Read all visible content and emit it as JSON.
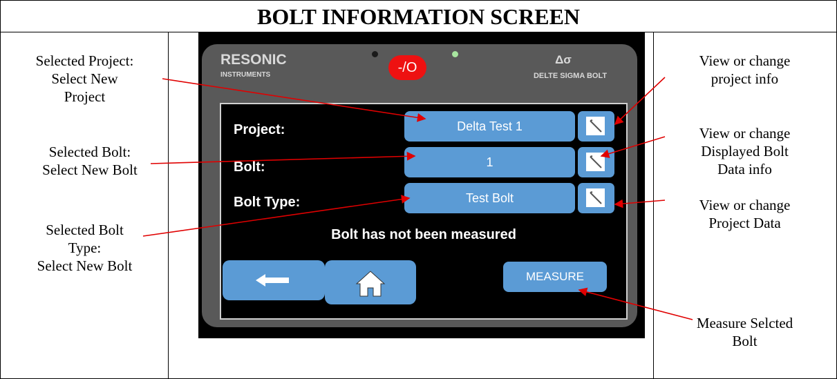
{
  "title": "BOLT INFORMATION SCREEN",
  "annotations": {
    "selected_project": [
      "Selected Project:",
      "Select New",
      "Project"
    ],
    "selected_bolt": [
      "Selected Bolt:",
      "Select New Bolt"
    ],
    "selected_bolt_type": [
      "Selected Bolt",
      "Type:",
      "Select New Bolt"
    ],
    "project_info": [
      "View or change",
      "project info"
    ],
    "bolt_data_info": [
      "View or change",
      "Displayed Bolt",
      "Data info"
    ],
    "project_data": [
      "View or change",
      "Project Data"
    ],
    "measure": [
      "Measure Selcted",
      "Bolt"
    ]
  },
  "device": {
    "brand": "RESONIC",
    "brand_sub": "INSTRUMENTS",
    "logo_symbol": "Δσ",
    "logo_sub": "DELTE SIGMA BOLT",
    "power_label": "-/O",
    "led_left_color": "#1a1a1a",
    "led_right_color": "#a8e6a0",
    "accent_color": "#5b9bd5",
    "screen": {
      "project_label": "Project:",
      "project_value": "Delta Test 1",
      "bolt_label": "Bolt:",
      "bolt_value": "1",
      "bolt_type_label": "Bolt Type:",
      "bolt_type_value": "Test Bolt",
      "status": "Bolt has not been measured",
      "measure_label": "MEASURE",
      "icons": {
        "edit": "pencil-edit-icon",
        "back": "left-arrow-icon",
        "home": "home-icon"
      }
    }
  }
}
